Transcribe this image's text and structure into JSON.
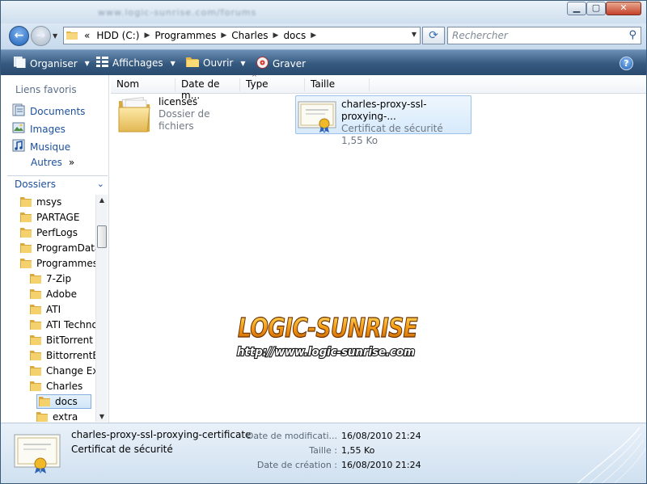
{
  "window": {
    "title": "www.logic-sunrise.com/forums"
  },
  "address": {
    "crumbs": [
      "HDD (C:)",
      "Programmes",
      "Charles",
      "docs"
    ],
    "overflow": "«"
  },
  "search": {
    "placeholder": "Rechercher"
  },
  "toolbar": {
    "organize": "Organiser",
    "views": "Affichages",
    "open": "Ouvrir",
    "burn": "Graver"
  },
  "favorites": {
    "heading": "Liens favoris",
    "items": [
      "Documents",
      "Images",
      "Musique"
    ],
    "more": "Autres",
    "more_chevron": "»"
  },
  "folders": {
    "heading": "Dossiers",
    "tree": [
      {
        "label": "msys"
      },
      {
        "label": "PARTAGE"
      },
      {
        "label": "PerfLogs"
      },
      {
        "label": "ProgramData"
      },
      {
        "label": "Programmes"
      },
      {
        "label": "7-Zip"
      },
      {
        "label": "Adobe"
      },
      {
        "label": "ATI"
      },
      {
        "label": "ATI Technologies"
      },
      {
        "label": "BitTorrent"
      },
      {
        "label": "BittorrentBar"
      },
      {
        "label": "Change Ext"
      },
      {
        "label": "Charles"
      },
      {
        "label": "docs"
      },
      {
        "label": "extra"
      }
    ]
  },
  "columns": {
    "name": "Nom",
    "date": "Date de m...",
    "type": "Type",
    "size": "Taille"
  },
  "files": [
    {
      "name": "licenses",
      "line2": "Dossier de fichiers",
      "line3": ""
    },
    {
      "name": "charles-proxy-ssl-proxying-...",
      "line2": "Certificat de sécurité",
      "line3": "1,55 Ko"
    }
  ],
  "watermark": {
    "line1": "LOGIC-SUNRISE",
    "line2": "http://www.logic-sunrise.com"
  },
  "details": {
    "name": "charles-proxy-ssl-proxying-certificate",
    "type": "Certificat de sécurité",
    "modified_label": "Date de modificati...",
    "modified": "16/08/2010 21:24",
    "size_label": "Taille :",
    "size": "1,55 Ko",
    "created_label": "Date de création :",
    "created": "16/08/2010 21:24"
  }
}
